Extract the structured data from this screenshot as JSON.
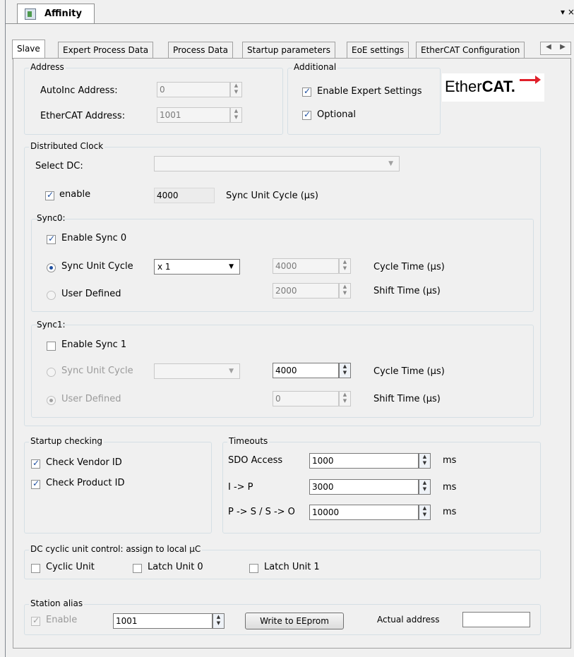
{
  "window": {
    "tab_title": "Affinity",
    "menu_glyph": "▾ ×"
  },
  "tabs": [
    "Slave",
    "Expert Process Data",
    "Process Data",
    "Startup parameters",
    "EoE settings",
    "EtherCAT Configuration"
  ],
  "tab_scroll": {
    "left": "◀",
    "right": "▶"
  },
  "logo": {
    "plain": "Ether",
    "bold": "CAT."
  },
  "address": {
    "title": "Address",
    "autoinc_label": "AutoInc Address:",
    "autoinc_value": "0",
    "ethercat_label": "EtherCAT Address:",
    "ethercat_value": "1001"
  },
  "additional": {
    "title": "Additional",
    "expert_label": "Enable Expert Settings",
    "expert_checked": true,
    "optional_label": "Optional",
    "optional_checked": true
  },
  "dc": {
    "title": "Distributed Clock",
    "select_label": "Select DC:",
    "select_value": "",
    "enable_label": "enable",
    "enable_checked": true,
    "sync_unit_cycle_value": "4000",
    "sync_unit_cycle_label": "Sync Unit Cycle (µs)"
  },
  "sync0": {
    "title": "Sync0:",
    "enable_label": "Enable Sync 0",
    "enable_checked": true,
    "sync_unit_cycle_label": "Sync Unit Cycle",
    "sync_unit_cycle_selected": true,
    "multiplier": "x 1",
    "cycle_time_value": "4000",
    "cycle_time_label": "Cycle Time (µs)",
    "user_defined_label": "User Defined",
    "shift_time_value": "2000",
    "shift_time_label": "Shift Time (µs)"
  },
  "sync1": {
    "title": "Sync1:",
    "enable_label": "Enable Sync 1",
    "enable_checked": false,
    "sync_unit_cycle_label": "Sync Unit Cycle",
    "multiplier": "",
    "cycle_time_value": "4000",
    "cycle_time_label": "Cycle Time (µs)",
    "user_defined_label": "User Defined",
    "user_defined_selected": true,
    "shift_time_value": "0",
    "shift_time_label": "Shift Time (µs)"
  },
  "startup": {
    "title": "Startup checking",
    "vendor_label": "Check Vendor ID",
    "vendor_checked": true,
    "product_label": "Check Product ID",
    "product_checked": true
  },
  "timeouts": {
    "title": "Timeouts",
    "rows": [
      {
        "label": "SDO Access",
        "value": "1000",
        "unit": "ms"
      },
      {
        "label": "I -> P",
        "value": "3000",
        "unit": "ms"
      },
      {
        "label": "P -> S / S -> O",
        "value": "10000",
        "unit": "ms"
      }
    ]
  },
  "dc_unit": {
    "title": "DC cyclic unit control: assign to local µC",
    "cyclic_label": "Cyclic Unit",
    "latch0_label": "Latch Unit 0",
    "latch1_label": "Latch Unit 1"
  },
  "alias": {
    "title": "Station alias",
    "enable_label": "Enable",
    "enable_checked": true,
    "value": "1001",
    "write_button": "Write to EEprom",
    "actual_label": "Actual address",
    "actual_value": ""
  },
  "spin_glyph": "▲\n▼"
}
